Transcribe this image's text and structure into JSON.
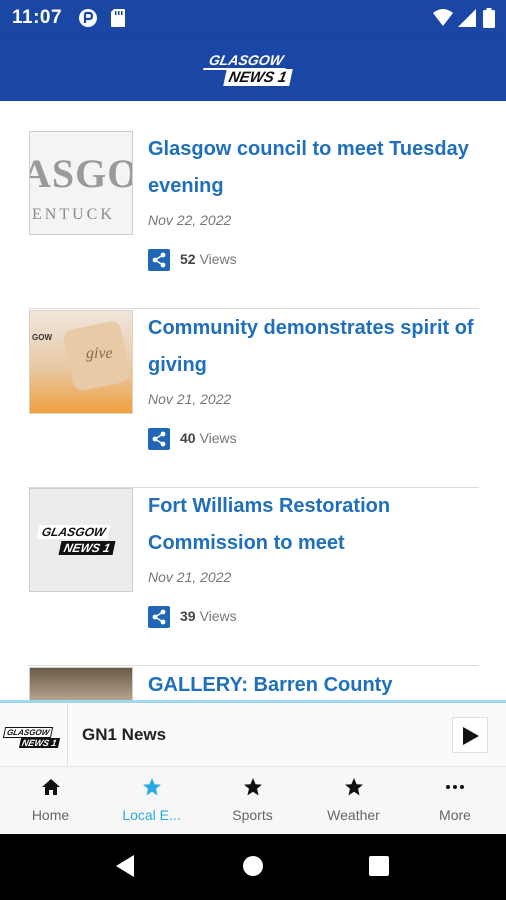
{
  "status": {
    "time": "11:07"
  },
  "header": {
    "logo_top": "GLASGOW",
    "logo_bottom": "NEWS 1"
  },
  "articles": [
    {
      "title": "Glasgow council to meet Tuesday evening",
      "date": "Nov 22, 2022",
      "views_count": "52",
      "views_label": "Views",
      "thumb_text_top": "ASGO",
      "thumb_text_bottom": "ENTUCK"
    },
    {
      "title": "Community demonstrates spirit of giving",
      "date": "Nov 21, 2022",
      "views_count": "40",
      "views_label": "Views",
      "thumb_text_top": "give",
      "thumb_text_bottom": "GOW"
    },
    {
      "title": "Fort Williams Restoration Commission to meet",
      "date": "Nov 21, 2022",
      "views_count": "39",
      "views_label": "Views",
      "thumb_logo_top": "GLASGOW",
      "thumb_logo_bottom": "NEWS 1"
    },
    {
      "title": "GALLERY: Barren County"
    }
  ],
  "player": {
    "station_name": "GN1 News",
    "logo_top": "GLASGOW",
    "logo_bottom": "NEWS 1"
  },
  "nav": {
    "items": [
      {
        "label": "Home",
        "icon": "home-icon"
      },
      {
        "label": "Local E...",
        "icon": "star-icon",
        "active": true
      },
      {
        "label": "Sports",
        "icon": "star-icon"
      },
      {
        "label": "Weather",
        "icon": "star-icon"
      },
      {
        "label": "More",
        "icon": "more-icon"
      }
    ]
  },
  "colors": {
    "brand": "#1a47a6",
    "link": "#1f6fbd",
    "active": "#29abe2"
  }
}
